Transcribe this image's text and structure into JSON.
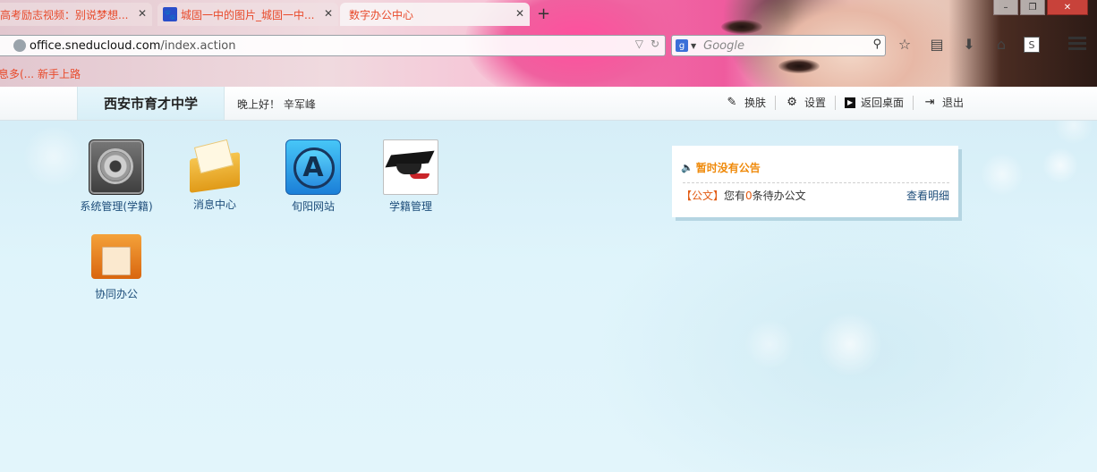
{
  "browser": {
    "tabs": [
      {
        "label": "高考励志视频：别说梦想...",
        "active": false
      },
      {
        "label": "城固一中的图片_城固一中...",
        "active": false
      },
      {
        "label": "数字办公中心",
        "active": true
      }
    ],
    "url": {
      "domain": "office.sneducloud.com",
      "path": "/index.action"
    },
    "search": {
      "engine": "Google",
      "placeholder": "Google"
    },
    "bookmark": "息多(...  新手上路",
    "accent_color": "#e84a2b"
  },
  "header": {
    "school_name": "西安市育才中学",
    "greeting": "晚上好！ 辛军峰",
    "actions": [
      {
        "label": "换肤",
        "icon": "skin-icon"
      },
      {
        "label": "设置",
        "icon": "gear-icon"
      },
      {
        "label": "返回桌面",
        "icon": "desktop-icon"
      },
      {
        "label": "退出",
        "icon": "logout-icon"
      }
    ]
  },
  "apps": [
    {
      "label": "系统管理(学籍)",
      "icon": "system-settings-icon"
    },
    {
      "label": "消息中心",
      "icon": "mail-icon"
    },
    {
      "label": "旬阳网站",
      "icon": "app-store-icon"
    },
    {
      "label": "学籍管理",
      "icon": "graduation-cap-icon"
    },
    {
      "label": "协同办公",
      "icon": "folder-tools-icon"
    }
  ],
  "notice": {
    "title": "暂时没有公告",
    "badge": "【公文】",
    "text_prefix": "您有",
    "count": "0",
    "text_suffix": "条待办公文",
    "link": "查看明细",
    "title_color": "#ef8a0b"
  }
}
